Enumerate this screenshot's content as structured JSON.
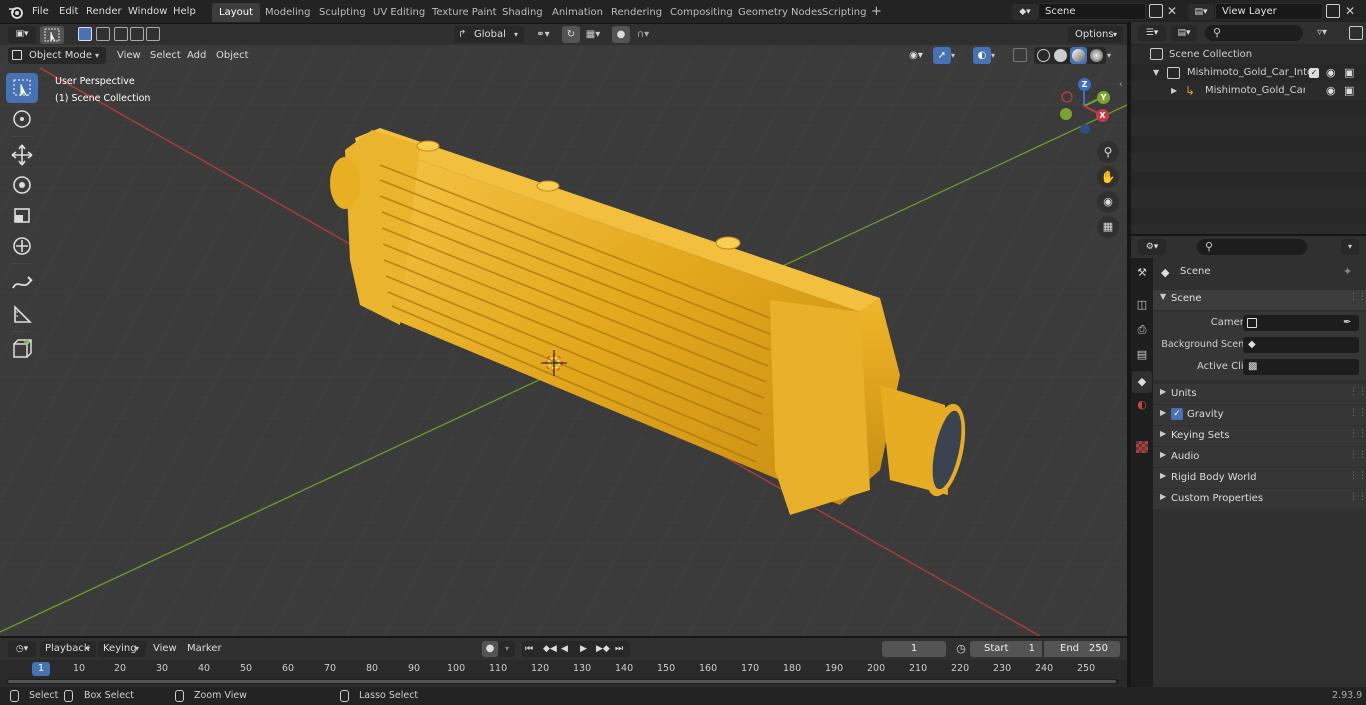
{
  "topbar": {
    "menu": [
      "File",
      "Edit",
      "Render",
      "Window",
      "Help"
    ],
    "workspaces": [
      "Layout",
      "Modeling",
      "Sculpting",
      "UV Editing",
      "Texture Paint",
      "Shading",
      "Animation",
      "Rendering",
      "Compositing",
      "Geometry Nodes",
      "Scripting"
    ],
    "active_workspace": "Layout",
    "add_tab": "+",
    "scene": "Scene",
    "view_layer": "View Layer"
  },
  "viewport_header": {
    "mode": "Object Mode",
    "menus": [
      "View",
      "Select",
      "Add",
      "Object"
    ],
    "transform_orientation": "Global",
    "options": "Options"
  },
  "viewport": {
    "perspective": "User Perspective",
    "collection": "(1) Scene Collection",
    "gizmo": {
      "x": "X",
      "y": "Y",
      "z": "Z"
    }
  },
  "outliner": {
    "root": "Scene Collection",
    "items": [
      {
        "label": "Mishimoto_Gold_Car_Intercoo"
      },
      {
        "label": "Mishimoto_Gold_Car_Inte"
      }
    ]
  },
  "properties": {
    "context": "Scene",
    "panel_title": "Scene",
    "fields": [
      {
        "label": "Camera"
      },
      {
        "label": "Background Scene"
      },
      {
        "label": "Active Clip"
      }
    ],
    "sections": [
      "Units",
      "Gravity",
      "Keying Sets",
      "Audio",
      "Rigid Body World",
      "Custom Properties"
    ]
  },
  "timeline": {
    "menus": [
      "Playback",
      "Keying",
      "View",
      "Marker"
    ],
    "current_frame": "1",
    "start_label": "Start",
    "start": "1",
    "end_label": "End",
    "end": "250",
    "ruler": [
      "1",
      "10",
      "20",
      "30",
      "40",
      "50",
      "60",
      "70",
      "80",
      "90",
      "100",
      "110",
      "120",
      "130",
      "140",
      "150",
      "160",
      "170",
      "180",
      "190",
      "200",
      "210",
      "220",
      "230",
      "240",
      "250"
    ]
  },
  "statusbar": {
    "select": "Select",
    "box_select": "Box Select",
    "zoom_view": "Zoom View",
    "lasso_select": "Lasso Select",
    "version": "2.93.9"
  },
  "colors": {
    "accent": "#4772b3",
    "object": "#e8ae1e",
    "x_axis": "#b43c3c",
    "y_axis": "#6e9a2c"
  }
}
